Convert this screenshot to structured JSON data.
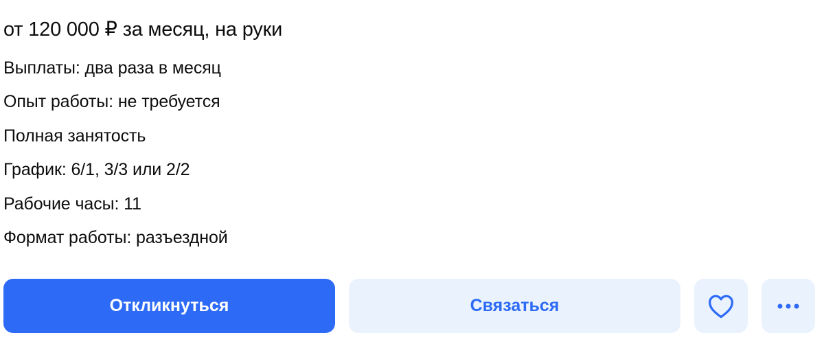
{
  "vacancy": {
    "salary": "от 120 000 ₽ за месяц, на руки",
    "details": [
      "Выплаты: два раза в месяц",
      "Опыт работы: не требуется",
      "Полная занятость",
      "График: 6/1, 3/3 или 2/2",
      "Рабочие часы: 11",
      "Формат работы: разъездной"
    ]
  },
  "actions": {
    "respond_label": "Откликнуться",
    "contact_label": "Связаться",
    "favorite_icon": "heart-icon",
    "more_icon": "more-icon"
  },
  "colors": {
    "accent": "#2d6bf6",
    "secondary_bg": "#eaf2fd",
    "text": "#0d0d0f"
  }
}
